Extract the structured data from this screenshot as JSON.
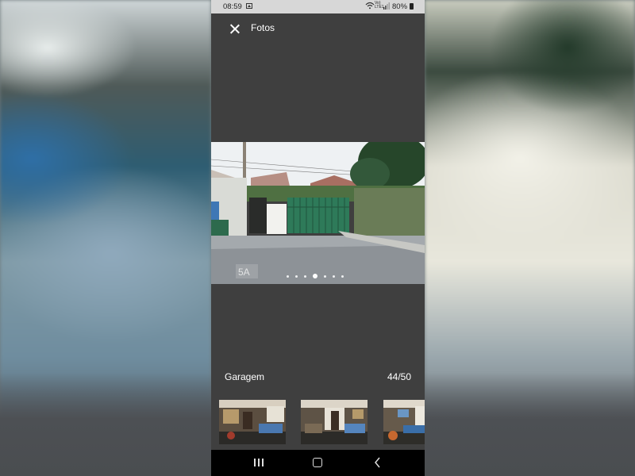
{
  "status_bar": {
    "time": "08:59",
    "network": "Vo) LTE1",
    "battery": "80%",
    "icons": [
      "gallery-icon",
      "wifi-icon",
      "signal-icon",
      "battery-icon"
    ]
  },
  "header": {
    "title": "Fotos",
    "close_icon": "close-icon"
  },
  "photo": {
    "caption": "Garagem",
    "counter": "44/50",
    "pager": {
      "count": 7,
      "active_index": 3
    },
    "watermark_text": "5A"
  },
  "thumbnails": [
    "living-room-photo-1",
    "living-room-photo-2",
    "living-room-photo-3"
  ],
  "nav_bar": {
    "icons": [
      "recent-apps-icon",
      "home-icon",
      "back-icon"
    ]
  },
  "colors": {
    "viewer_background": "#3f3f3f",
    "status_bar": "#d7d7d7",
    "nav_bar": "#000000",
    "gate_green": "#2e7a59"
  }
}
